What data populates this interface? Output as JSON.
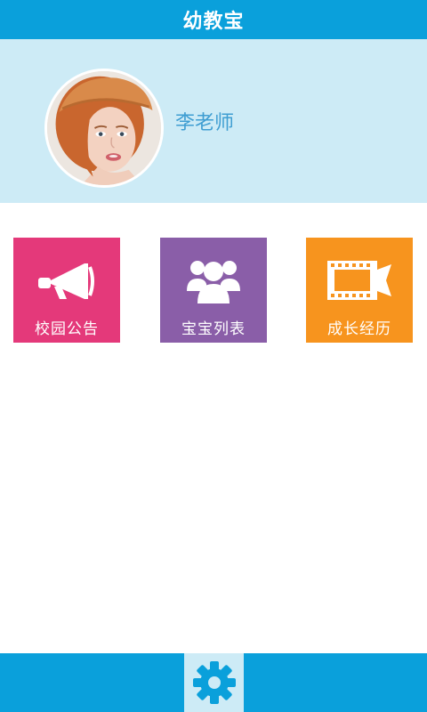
{
  "app": {
    "title": "幼教宝"
  },
  "profile": {
    "name": "李老师",
    "avatar_icon": "teacher-avatar-photo"
  },
  "tiles": [
    {
      "label": "校园公告",
      "icon": "megaphone-icon",
      "color": "#e4397a"
    },
    {
      "label": "宝宝列表",
      "icon": "group-icon",
      "color": "#8a5ea8"
    },
    {
      "label": "成长经历",
      "icon": "film-strip-icon",
      "color": "#f7941e"
    }
  ],
  "bottom_bar": {
    "settings_icon": "gear-icon"
  },
  "colors": {
    "primary": "#0aa0db",
    "profile_bg": "#cdebf6",
    "name_text": "#3f9ed2"
  }
}
